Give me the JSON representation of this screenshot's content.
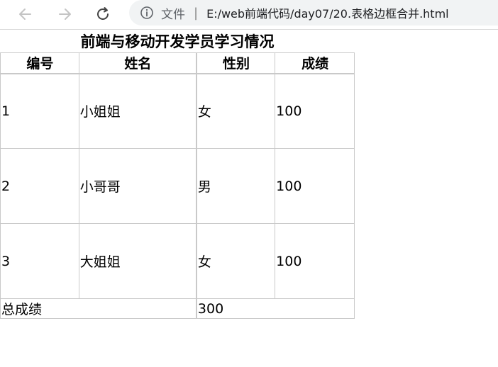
{
  "browser": {
    "scheme_label": "文件",
    "separator": "|",
    "url": "E:/web前端代码/day07/20.表格边框合并.html",
    "icons": {
      "back": "arrow-left-icon",
      "forward": "arrow-right-icon",
      "reload": "reload-icon",
      "info": "info-circle-icon"
    }
  },
  "table": {
    "caption": "前端与移动开发学员学习情况",
    "headers": [
      "编号",
      "姓名",
      "性别",
      "成绩"
    ],
    "rows": [
      [
        "1",
        "小姐姐",
        "女",
        "100"
      ],
      [
        "2",
        "小哥哥",
        "男",
        "100"
      ],
      [
        "3",
        "大姐姐",
        "女",
        "100"
      ]
    ],
    "total_label": "总成绩",
    "total_value": "300"
  }
}
